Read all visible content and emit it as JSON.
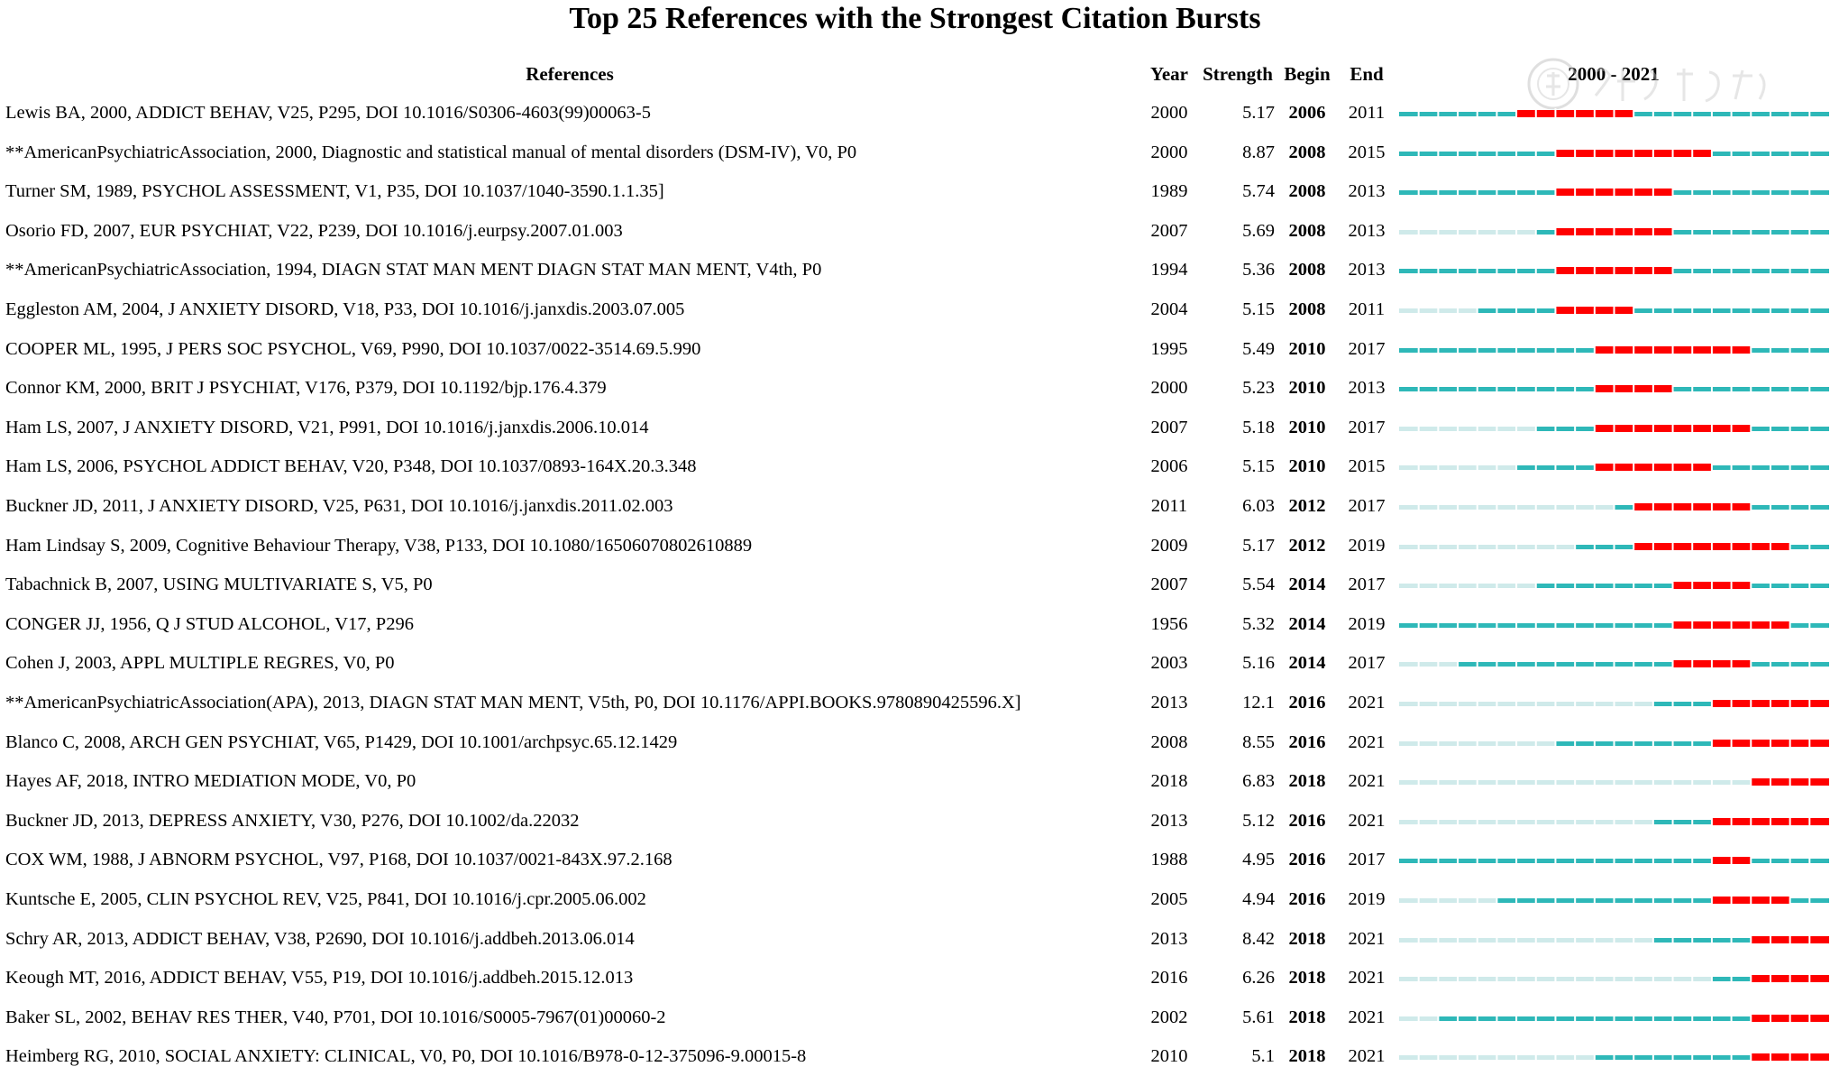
{
  "chart_data": {
    "type": "table",
    "title": "Top 25 References with the Strongest Citation Bursts",
    "columns": [
      "References",
      "Year",
      "Strength",
      "Begin",
      "End",
      "2000 - 2021"
    ],
    "range_start": 2000,
    "range_end": 2021,
    "colors": {
      "burst": "#ff0000",
      "active": "#2eb8b8",
      "pre": "#cfeaea"
    },
    "rows": [
      {
        "ref": "Lewis BA, 2000, ADDICT BEHAV, V25, P295, DOI 10.1016/S0306-4603(99)00063-5",
        "year": "2000",
        "strength": "5.17",
        "begin": "2006",
        "end": "2011"
      },
      {
        "ref": "**AmericanPsychiatricAssociation, 2000, Diagnostic and statistical manual of mental disorders (DSM-IV), V0, P0",
        "year": "2000",
        "strength": "8.87",
        "begin": "2008",
        "end": "2015"
      },
      {
        "ref": "Turner SM, 1989, PSYCHOL ASSESSMENT, V1, P35, DOI 10.1037/1040-3590.1.1.35]",
        "year": "1989",
        "strength": "5.74",
        "begin": "2008",
        "end": "2013"
      },
      {
        "ref": "Osorio FD, 2007, EUR PSYCHIAT, V22, P239, DOI 10.1016/j.eurpsy.2007.01.003",
        "year": "2007",
        "strength": "5.69",
        "begin": "2008",
        "end": "2013"
      },
      {
        "ref": "**AmericanPsychiatricAssociation, 1994, DIAGN STAT MAN MENT DIAGN STAT MAN MENT, V4th, P0",
        "year": "1994",
        "strength": "5.36",
        "begin": "2008",
        "end": "2013"
      },
      {
        "ref": "Eggleston AM, 2004, J ANXIETY DISORD, V18, P33, DOI 10.1016/j.janxdis.2003.07.005",
        "year": "2004",
        "strength": "5.15",
        "begin": "2008",
        "end": "2011"
      },
      {
        "ref": "COOPER ML, 1995, J PERS SOC PSYCHOL, V69, P990, DOI 10.1037/0022-3514.69.5.990",
        "year": "1995",
        "strength": "5.49",
        "begin": "2010",
        "end": "2017"
      },
      {
        "ref": "Connor KM, 2000, BRIT J PSYCHIAT, V176, P379, DOI 10.1192/bjp.176.4.379",
        "year": "2000",
        "strength": "5.23",
        "begin": "2010",
        "end": "2013"
      },
      {
        "ref": "Ham LS, 2007, J ANXIETY DISORD, V21, P991, DOI 10.1016/j.janxdis.2006.10.014",
        "year": "2007",
        "strength": "5.18",
        "begin": "2010",
        "end": "2017"
      },
      {
        "ref": "Ham LS, 2006, PSYCHOL ADDICT BEHAV, V20, P348, DOI 10.1037/0893-164X.20.3.348",
        "year": "2006",
        "strength": "5.15",
        "begin": "2010",
        "end": "2015"
      },
      {
        "ref": "Buckner JD, 2011, J ANXIETY DISORD, V25, P631, DOI 10.1016/j.janxdis.2011.02.003",
        "year": "2011",
        "strength": "6.03",
        "begin": "2012",
        "end": "2017"
      },
      {
        "ref": "Ham Lindsay S, 2009, Cognitive Behaviour Therapy, V38, P133, DOI 10.1080/16506070802610889",
        "year": "2009",
        "strength": "5.17",
        "begin": "2012",
        "end": "2019"
      },
      {
        "ref": "Tabachnick B, 2007, USING MULTIVARIATE S, V5, P0",
        "year": "2007",
        "strength": "5.54",
        "begin": "2014",
        "end": "2017"
      },
      {
        "ref": "CONGER JJ, 1956, Q J STUD ALCOHOL, V17, P296",
        "year": "1956",
        "strength": "5.32",
        "begin": "2014",
        "end": "2019"
      },
      {
        "ref": "Cohen J, 2003, APPL MULTIPLE REGRES, V0, P0",
        "year": "2003",
        "strength": "5.16",
        "begin": "2014",
        "end": "2017"
      },
      {
        "ref": "**AmericanPsychiatricAssociation(APA), 2013, DIAGN STAT MAN MENT, V5th, P0, DOI 10.1176/APPI.BOOKS.9780890425596.X]",
        "year": "2013",
        "strength": "12.1",
        "begin": "2016",
        "end": "2021"
      },
      {
        "ref": "Blanco C, 2008, ARCH GEN PSYCHIAT, V65, P1429, DOI 10.1001/archpsyc.65.12.1429",
        "year": "2008",
        "strength": "8.55",
        "begin": "2016",
        "end": "2021"
      },
      {
        "ref": "Hayes AF, 2018, INTRO MEDIATION MODE, V0, P0",
        "year": "2018",
        "strength": "6.83",
        "begin": "2018",
        "end": "2021"
      },
      {
        "ref": "Buckner JD, 2013, DEPRESS ANXIETY, V30, P276, DOI 10.1002/da.22032",
        "year": "2013",
        "strength": "5.12",
        "begin": "2016",
        "end": "2021"
      },
      {
        "ref": "COX WM, 1988, J ABNORM PSYCHOL, V97, P168, DOI 10.1037/0021-843X.97.2.168",
        "year": "1988",
        "strength": "4.95",
        "begin": "2016",
        "end": "2017"
      },
      {
        "ref": "Kuntsche E, 2005, CLIN PSYCHOL REV, V25, P841, DOI 10.1016/j.cpr.2005.06.002",
        "year": "2005",
        "strength": "4.94",
        "begin": "2016",
        "end": "2019"
      },
      {
        "ref": "Schry AR, 2013, ADDICT BEHAV, V38, P2690, DOI 10.1016/j.addbeh.2013.06.014",
        "year": "2013",
        "strength": "8.42",
        "begin": "2018",
        "end": "2021"
      },
      {
        "ref": "Keough MT, 2016, ADDICT BEHAV, V55, P19, DOI 10.1016/j.addbeh.2015.12.013",
        "year": "2016",
        "strength": "6.26",
        "begin": "2018",
        "end": "2021"
      },
      {
        "ref": "Baker SL, 2002, BEHAV RES THER, V40, P701, DOI 10.1016/S0005-7967(01)00060-2",
        "year": "2002",
        "strength": "5.61",
        "begin": "2018",
        "end": "2021"
      },
      {
        "ref": "Heimberg RG, 2010, SOCIAL ANXIETY: CLINICAL, V0, P0, DOI 10.1016/B978-0-12-375096-9.00015-8",
        "year": "2010",
        "strength": "5.1",
        "begin": "2018",
        "end": "2021"
      }
    ]
  }
}
